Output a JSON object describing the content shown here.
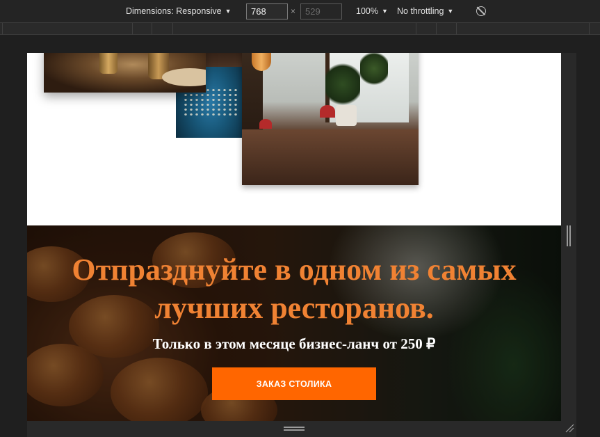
{
  "devtools": {
    "dimensions_label": "Dimensions: Responsive",
    "width": "768",
    "height_placeholder": "529",
    "times": "×",
    "zoom": "100%",
    "throttling": "No throttling",
    "caret": "▼"
  },
  "hero": {
    "title": "Отпразднуйте в одном из самых лучших ресторанов.",
    "subtitle": "Только в этом месяце бизнес-ланч от 250 ₽",
    "cta_label": "ЗАКАЗ СТОЛИКА"
  },
  "colors": {
    "accent": "#ff6600",
    "title": "#f08233"
  }
}
